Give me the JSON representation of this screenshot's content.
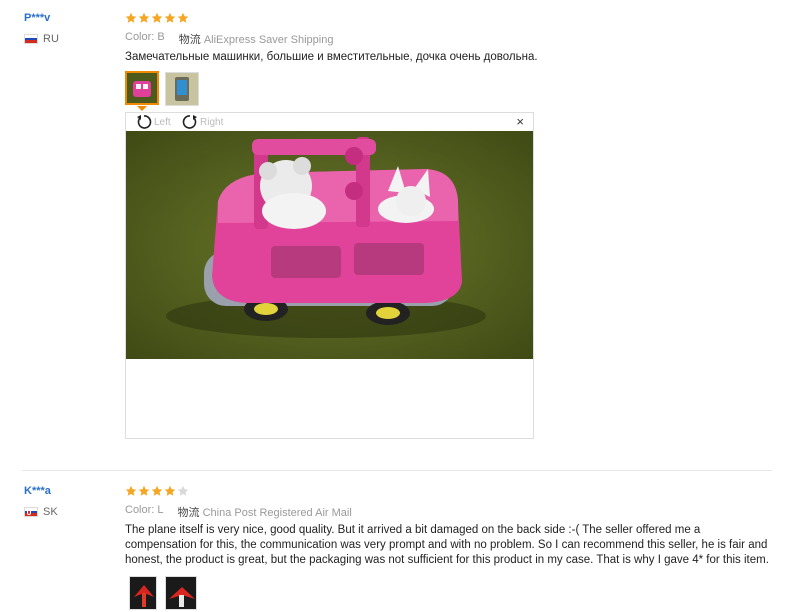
{
  "reviews": [
    {
      "user": "P***v",
      "country": "RU",
      "rating": 5,
      "color_label": "Color:",
      "color_value": "B",
      "shipping_label": "物流",
      "shipping_value": "AliExpress Saver Shipping",
      "text": "Замечательные машинки, большие и вместительные, дочка очень довольна.",
      "viewer": {
        "rotate_left": "Left",
        "rotate_right": "Right",
        "close": "×"
      }
    },
    {
      "user": "K***a",
      "country": "SK",
      "rating": 4,
      "color_label": "Color:",
      "color_value": "L",
      "shipping_label": "物流",
      "shipping_value": "China Post Registered Air Mail",
      "text": "The plane itself is very nice, good quality. But it arrived a bit damaged on the back side :-( The seller offered me a compensation for this, the communication was very prompt and with no problem. So I can recommend this seller, he is fair and honest, the product is great, but the packaging was not sufficient for this product in my case. That is why I gave 4* for this item."
    }
  ],
  "colors": {
    "accent": "#f08a00",
    "link": "#2a6fc9",
    "star_on": "#f5a623",
    "star_off": "#d9d9d9"
  }
}
